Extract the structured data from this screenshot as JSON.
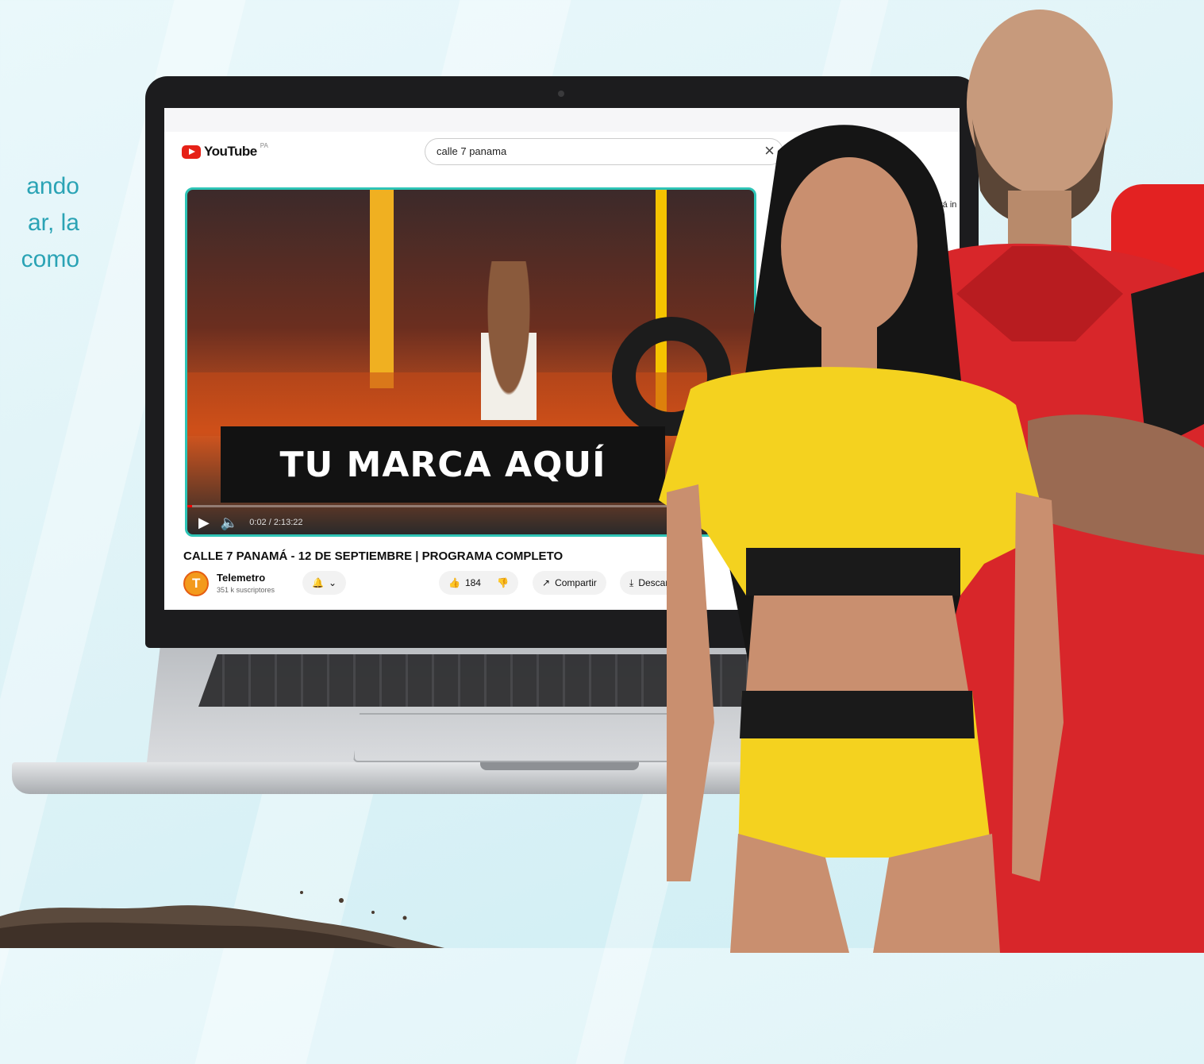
{
  "side_copy": {
    "lines": [
      "ando",
      "ar,  la",
      "como"
    ]
  },
  "youtube": {
    "logo_text": "YouTube",
    "region": "PA",
    "search": {
      "value": "calle 7 panama"
    },
    "side_snippet": "está in",
    "video": {
      "overlay_text": "TU MARCA AQUÍ",
      "time": "0:02 / 2:13:22",
      "progress_fraction": 0.0002
    },
    "title": "CALLE 7 PANAMÁ - 12 DE SEPTIEMBRE | PROGRAMA COMPLETO",
    "channel": {
      "name": "Telemetro",
      "subscribers": "351 k suscriptores"
    },
    "actions": {
      "likes": "184",
      "share_label": "Compartir",
      "download_label": "Descar"
    }
  },
  "colors": {
    "accent_teal": "#2aa3b5",
    "youtube_red": "#e62117",
    "jersey_yellow": "#f4d21f",
    "jersey_red": "#e32222"
  }
}
